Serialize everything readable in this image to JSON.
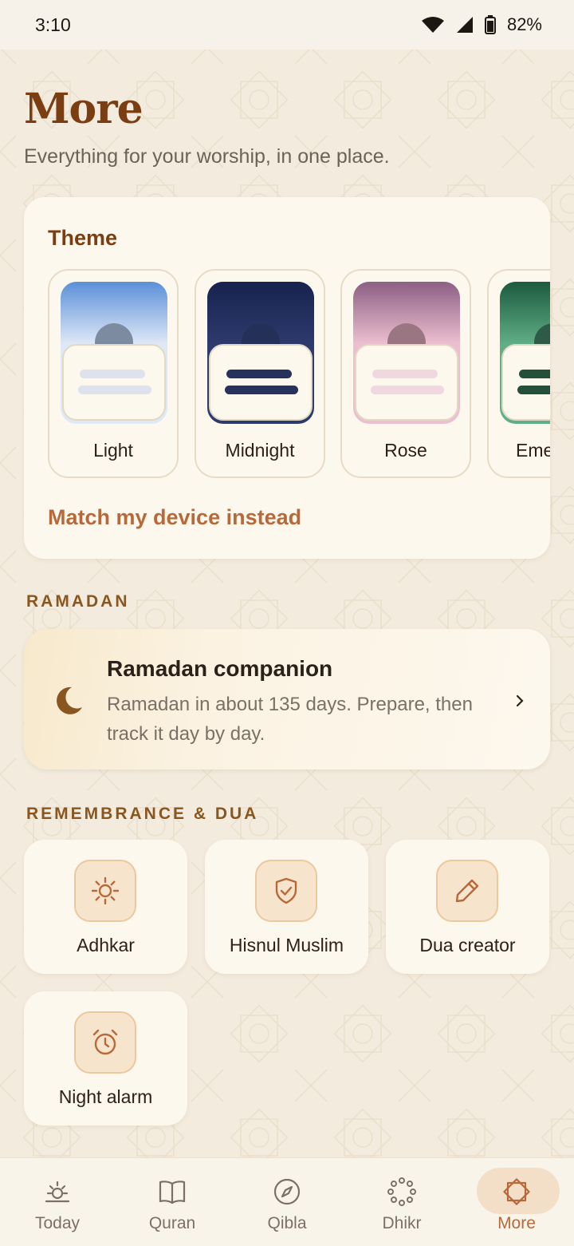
{
  "status_bar": {
    "time": "3:10",
    "battery": "82%"
  },
  "header": {
    "title": "More",
    "subtitle": "Everything for your worship, in one place."
  },
  "theme": {
    "title": "Theme",
    "options": [
      {
        "label": "Light",
        "sky_top": "#5b8fd9",
        "sky_bottom": "#dfe8f6",
        "sun": "#7d8ba0",
        "bar": "#dde2ee"
      },
      {
        "label": "Midnight",
        "sky_top": "#17224d",
        "sky_bottom": "#2d3a6d",
        "sun": "#253058",
        "bar": "#27325c"
      },
      {
        "label": "Rose",
        "sky_top": "#8c5f84",
        "sky_bottom": "#ecbfd0",
        "sun": "#9a7582",
        "bar": "#f0d7e0"
      },
      {
        "label": "Emerald",
        "sky_top": "#1c5a3e",
        "sky_bottom": "#5fae86",
        "sun": "#2f5a48",
        "bar": "#24503b"
      }
    ],
    "match_device": "Match my device instead"
  },
  "ramadan": {
    "section_label": "RAMADAN",
    "title": "Ramadan companion",
    "description": "Ramadan in about 135 days. Prepare, then track it day by day.",
    "icon": "crescent-moon-icon"
  },
  "remembrance": {
    "section_label": "REMEMBRANCE & DUA",
    "tiles": [
      {
        "label": "Adhkar",
        "icon": "sun-icon"
      },
      {
        "label": "Hisnul Muslim",
        "icon": "shield-check-icon"
      },
      {
        "label": "Dua creator",
        "icon": "pencil-icon"
      },
      {
        "label": "Night alarm",
        "icon": "alarm-clock-icon"
      }
    ]
  },
  "nav": {
    "items": [
      {
        "label": "Today",
        "icon": "sunrise-icon"
      },
      {
        "label": "Quran",
        "icon": "book-icon"
      },
      {
        "label": "Qibla",
        "icon": "compass-icon"
      },
      {
        "label": "Dhikr",
        "icon": "prayer-beads-icon"
      },
      {
        "label": "More",
        "icon": "star-icon",
        "active": true
      }
    ],
    "accent": "#b8693a"
  },
  "colors": {
    "accent": "#b8693a",
    "title": "#7a3e12",
    "background": "#f3ebdd",
    "card": "#fdf8ee"
  }
}
